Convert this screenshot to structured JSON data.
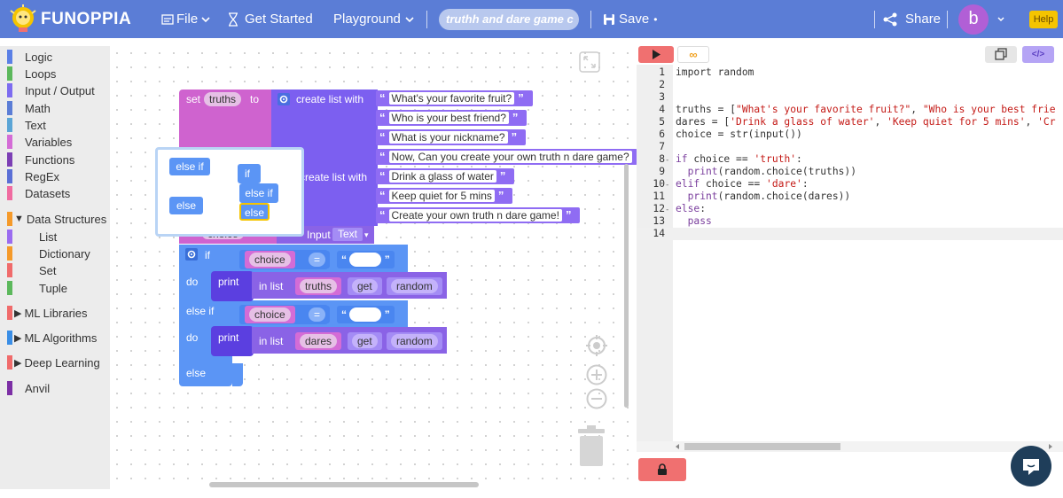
{
  "app": {
    "logo_text": "FUNOPPIA"
  },
  "topbar": {
    "file_label": "File",
    "get_started_label": "Get Started",
    "playground_label": "Playground",
    "project_name": "truthh and dare game c",
    "save_label": "Save",
    "save_dot": "•",
    "share_label": "Share",
    "avatar_letter": "b",
    "help_label": "Help"
  },
  "toolbox": {
    "categories": [
      {
        "label": "Logic",
        "color": "#5b80e6"
      },
      {
        "label": "Loops",
        "color": "#5cb85c"
      },
      {
        "label": "Input / Output",
        "color": "#7d6cf0"
      },
      {
        "label": "Math",
        "color": "#5b7dd6"
      },
      {
        "label": "Text",
        "color": "#5ba5d6"
      },
      {
        "label": "Variables",
        "color": "#d46cd6"
      },
      {
        "label": "Functions",
        "color": "#7c3fb5"
      },
      {
        "label": "RegEx",
        "color": "#5b6fd6"
      },
      {
        "label": "Datasets",
        "color": "#f06ba0"
      },
      {
        "label": "Data Structures",
        "color": "#f59a2a"
      },
      {
        "label": "List",
        "color": "#9b6cf0"
      },
      {
        "label": "Dictionary",
        "color": "#f59a2a"
      },
      {
        "label": "Set",
        "color": "#f06b6b"
      },
      {
        "label": "Tuple",
        "color": "#5cb85c"
      },
      {
        "label": "ML Libraries",
        "color": "#f06b6b"
      },
      {
        "label": "ML Algorithms",
        "color": "#3a8ee6"
      },
      {
        "label": "Deep Learning",
        "color": "#f06b6b"
      },
      {
        "label": "Anvil",
        "color": "#7c2fa5"
      }
    ]
  },
  "workspace": {
    "set_label": "set",
    "truths_var": "truths",
    "to_label": "to",
    "create_list_label": "create list with",
    "truths_items": [
      "What's your favorite fruit?",
      "Who is your best friend?",
      "What is your nickname?",
      "Now, Can you create your own truth n dare game?"
    ],
    "dares_items": [
      "Drink a glass of water",
      "Keep quiet for 5 mins",
      "Create your own truth n dare game!"
    ],
    "choice_var": "choice",
    "input_label": "Input",
    "text_type": "Text",
    "if_label": "if",
    "do_label": "do",
    "else_if_label": "else if",
    "else_label": "else",
    "print_label": "print",
    "in_list_label": "in list",
    "get_label": "get",
    "random_label": "random",
    "eq_label": "=",
    "truth_str": "truth",
    "dare_str": "dare",
    "dares_var": "dares",
    "flyout": {
      "else_if": "else if",
      "else": "else",
      "if": "if",
      "else_if2": "else if",
      "else2": "else"
    }
  },
  "editor": {
    "lines": [
      {
        "n": "1",
        "fold": "",
        "code": [
          {
            "t": "import random",
            "c": "fn"
          }
        ]
      },
      {
        "n": "2",
        "fold": "",
        "code": []
      },
      {
        "n": "3",
        "fold": "",
        "code": []
      },
      {
        "n": "4",
        "fold": "",
        "code": [
          {
            "t": "truths = [",
            "c": "fn"
          },
          {
            "t": "\"What's your favorite fruit?\"",
            "c": "str"
          },
          {
            "t": ", ",
            "c": "fn"
          },
          {
            "t": "\"Who is your best frie",
            "c": "str"
          }
        ]
      },
      {
        "n": "5",
        "fold": "",
        "code": [
          {
            "t": "dares = [",
            "c": "fn"
          },
          {
            "t": "'Drink a glass of water'",
            "c": "str"
          },
          {
            "t": ", ",
            "c": "fn"
          },
          {
            "t": "'Keep quiet for 5 mins'",
            "c": "str"
          },
          {
            "t": ", ",
            "c": "fn"
          },
          {
            "t": "'Cr",
            "c": "str"
          }
        ]
      },
      {
        "n": "6",
        "fold": "",
        "code": [
          {
            "t": "choice = str(input())",
            "c": "fn"
          }
        ]
      },
      {
        "n": "7",
        "fold": "",
        "code": []
      },
      {
        "n": "8",
        "fold": "▾",
        "code": [
          {
            "t": "if",
            "c": "kw"
          },
          {
            "t": " choice == ",
            "c": "fn"
          },
          {
            "t": "'truth'",
            "c": "str"
          },
          {
            "t": ":",
            "c": "fn"
          }
        ]
      },
      {
        "n": "9",
        "fold": "",
        "code": [
          {
            "t": "  print",
            "c": "kw"
          },
          {
            "t": "(random.choice(truths))",
            "c": "fn"
          }
        ]
      },
      {
        "n": "10",
        "fold": "▾",
        "code": [
          {
            "t": "elif",
            "c": "kw"
          },
          {
            "t": " choice == ",
            "c": "fn"
          },
          {
            "t": "'dare'",
            "c": "str"
          },
          {
            "t": ":",
            "c": "fn"
          }
        ]
      },
      {
        "n": "11",
        "fold": "",
        "code": [
          {
            "t": "  print",
            "c": "kw"
          },
          {
            "t": "(random.choice(dares))",
            "c": "fn"
          }
        ]
      },
      {
        "n": "12",
        "fold": "▾",
        "code": [
          {
            "t": "else",
            "c": "kw"
          },
          {
            "t": ":",
            "c": "fn"
          }
        ]
      },
      {
        "n": "13",
        "fold": "",
        "code": [
          {
            "t": "  pass",
            "c": "kw"
          }
        ]
      },
      {
        "n": "14",
        "fold": "",
        "code": []
      }
    ]
  },
  "colors": {
    "topbar": "#5b7dd6",
    "run": "#f07070",
    "chat": "#1f3e5a"
  }
}
